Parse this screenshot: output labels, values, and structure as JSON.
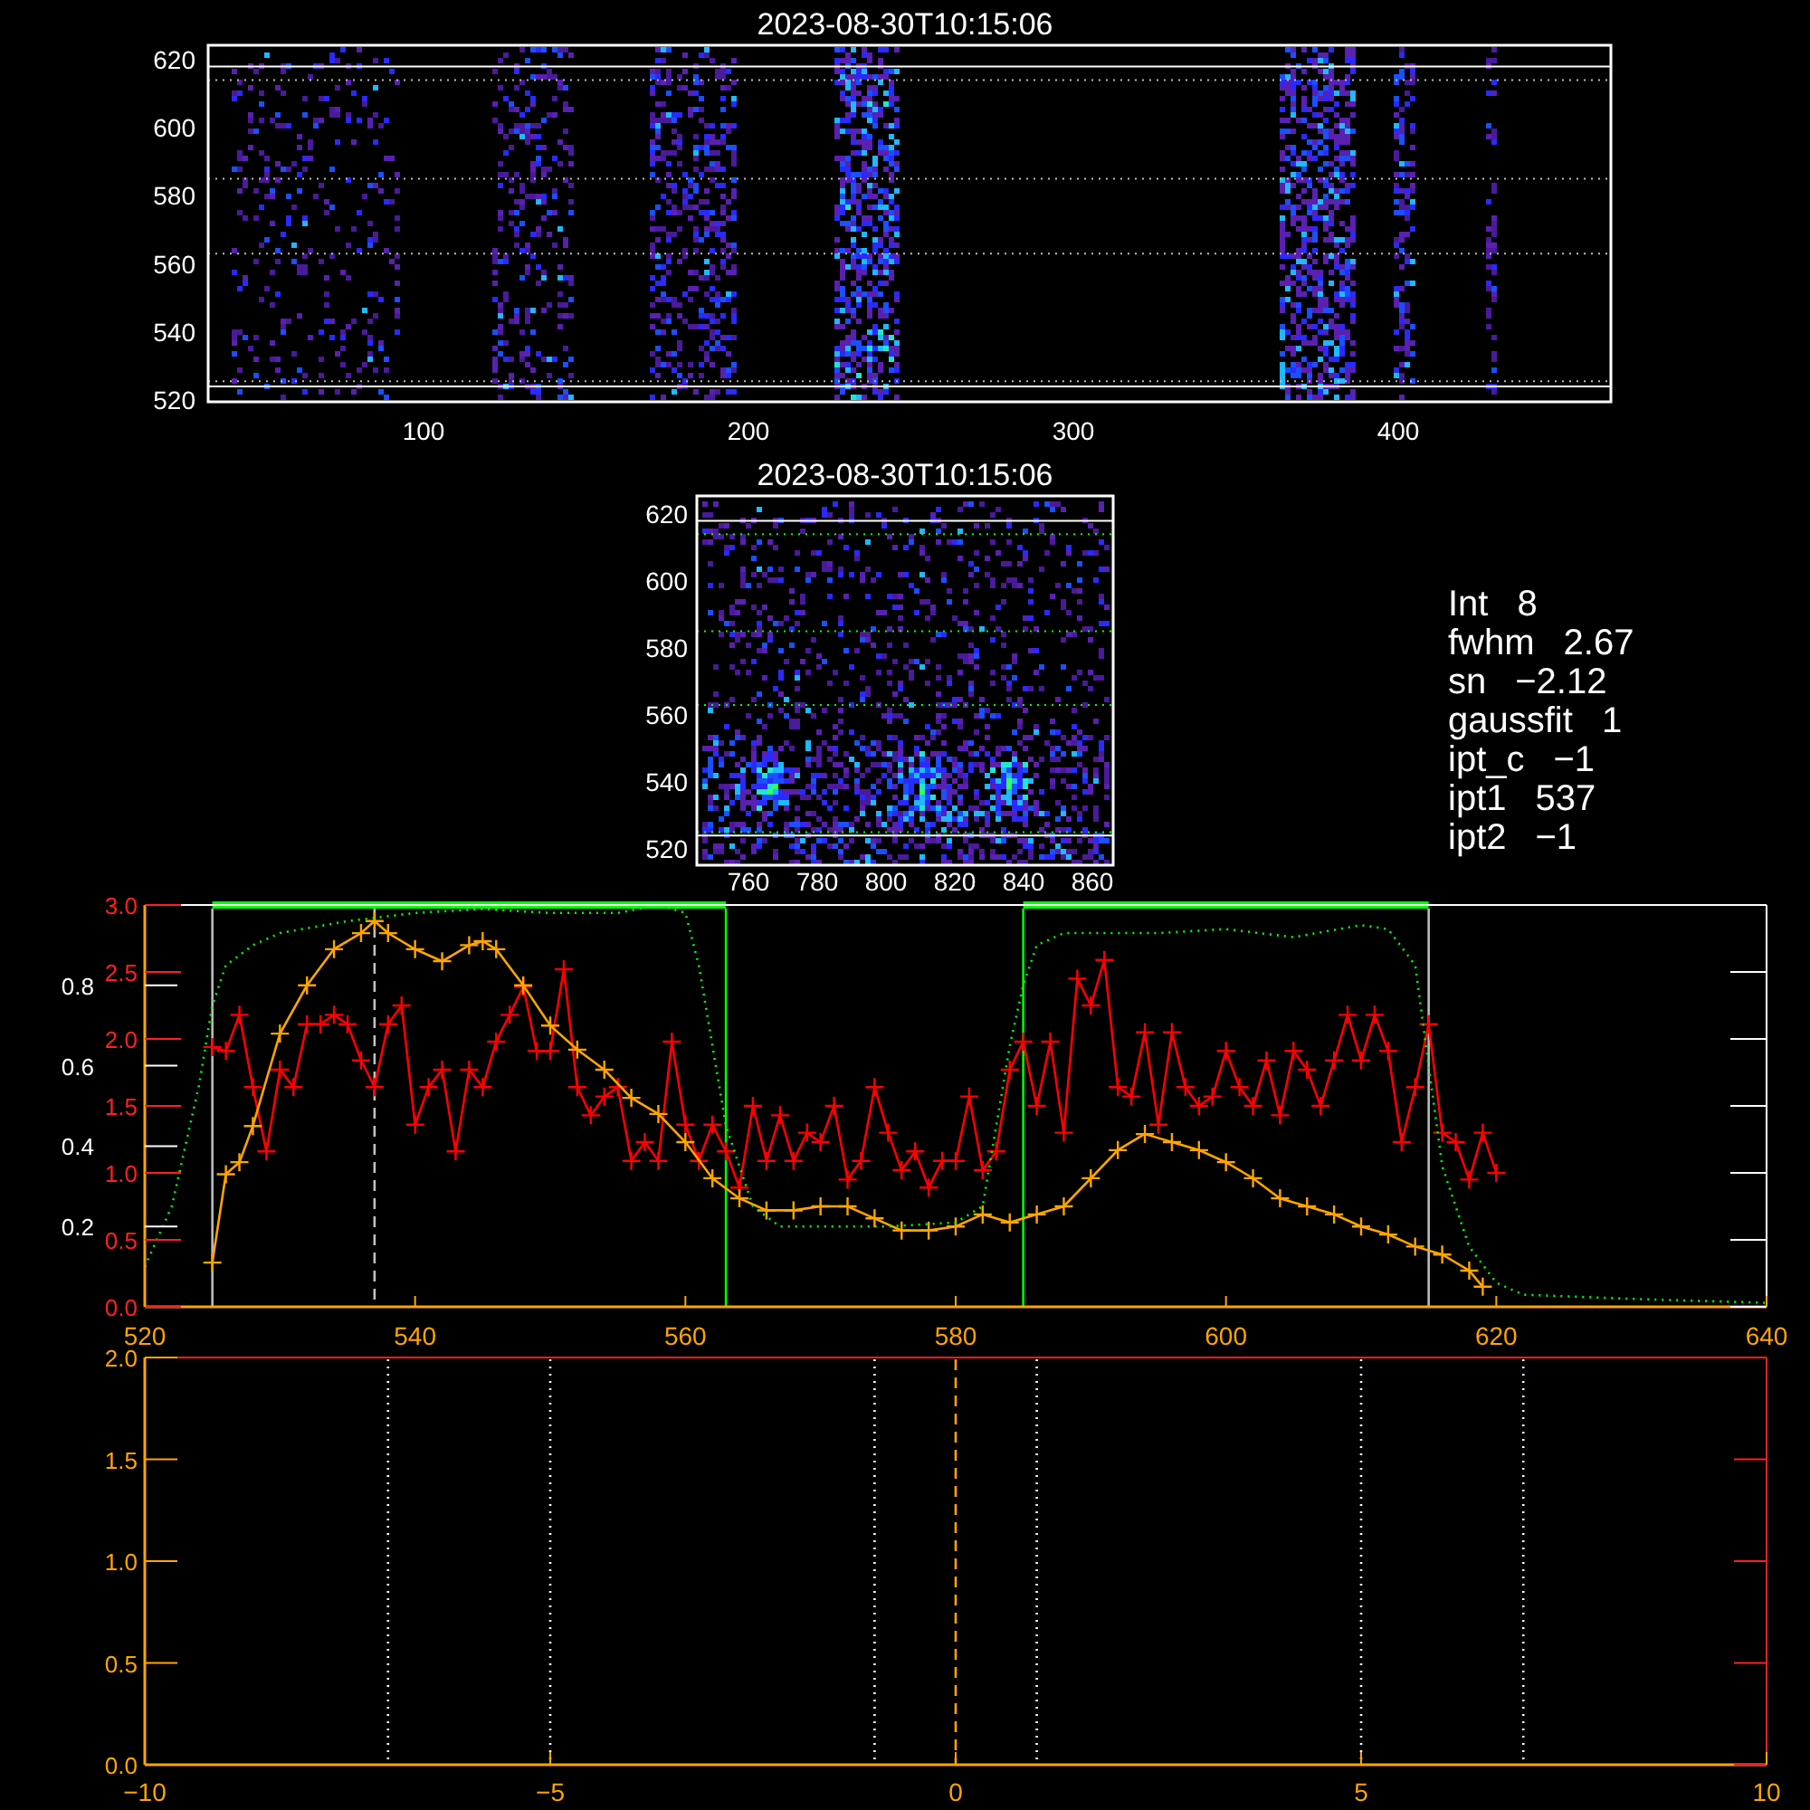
{
  "top_panel": {
    "title": "2023-08-30T10:15:06",
    "xticks": [
      "100",
      "200",
      "300",
      "400"
    ],
    "yticks": [
      "620",
      "600",
      "580",
      "560",
      "540",
      "520"
    ]
  },
  "middle_panel": {
    "title": "2023-08-30T10:15:06",
    "xticks": [
      "760",
      "780",
      "800",
      "820",
      "840",
      "860"
    ],
    "yticks": [
      "620",
      "600",
      "580",
      "560",
      "540",
      "520"
    ]
  },
  "fit_info": [
    {
      "label": "Int",
      "value": "8"
    },
    {
      "label": "fwhm",
      "value": "2.67"
    },
    {
      "label": "sn",
      "value": "−2.12"
    },
    {
      "label": "gaussfit",
      "value": "1"
    },
    {
      "label": "ipt_c",
      "value": "−1"
    },
    {
      "label": "ipt1",
      "value": "537"
    },
    {
      "label": "ipt2",
      "value": "−1"
    }
  ],
  "profile_panel": {
    "chart_data": {
      "type": "line",
      "xlim": [
        520,
        640
      ],
      "ylim": [
        0,
        3
      ],
      "xticks": [
        520,
        540,
        560,
        580,
        600,
        620,
        640
      ],
      "yticks": [
        {
          "value": 3,
          "label": "3.0"
        },
        {
          "value": 2.5,
          "label": "2.5"
        },
        {
          "value": 2,
          "label": "2.0"
        },
        {
          "value": 1.5,
          "label": "1.5"
        },
        {
          "value": 1,
          "label": "1.0"
        },
        {
          "value": 0.5,
          "label": "0.5"
        },
        {
          "value": 0,
          "label": "0.0"
        }
      ],
      "y2lim": [
        0,
        1
      ],
      "y2ticks": [
        {
          "value": 0.8,
          "label": "0.8"
        },
        {
          "value": 0.6,
          "label": "0.6"
        },
        {
          "value": 0.4,
          "label": "0.4"
        },
        {
          "value": 0.2,
          "label": "0.2"
        }
      ],
      "series": [
        {
          "color": "#ff0000",
          "marker": "+",
          "line_style": "solid",
          "x": [
            525,
            526,
            527,
            528,
            529,
            530,
            531,
            532,
            533,
            534,
            535,
            536,
            537,
            538,
            539,
            540,
            541,
            542,
            543,
            544,
            545,
            546,
            547,
            548,
            549,
            550,
            551,
            552,
            553,
            554,
            555,
            556,
            557,
            558,
            559,
            560,
            561,
            562,
            563,
            564,
            565,
            566,
            567,
            568,
            569,
            570,
            571,
            572,
            573,
            574,
            575,
            576,
            577,
            578,
            579,
            580,
            581,
            582,
            583,
            584,
            585,
            586,
            587,
            588,
            589,
            590,
            591,
            592,
            593,
            594,
            595,
            596,
            597,
            598,
            599,
            600,
            601,
            602,
            603,
            604,
            605,
            606,
            607,
            608,
            609,
            610,
            611,
            612,
            613,
            614,
            615,
            616,
            617,
            618,
            619,
            620
          ],
          "values": [
            1.94,
            1.91,
            2.18,
            1.64,
            1.16,
            1.77,
            1.64,
            2.11,
            2.11,
            2.18,
            2.11,
            1.84,
            1.64,
            2.11,
            2.25,
            1.36,
            1.64,
            1.77,
            1.16,
            1.77,
            1.64,
            1.98,
            2.18,
            2.39,
            1.91,
            1.91,
            2.52,
            1.64,
            1.43,
            1.57,
            1.64,
            1.09,
            1.23,
            1.09,
            1.98,
            1.36,
            1.09,
            1.36,
            1.16,
            0.89,
            1.5,
            1.09,
            1.43,
            1.09,
            1.3,
            1.23,
            1.5,
            0.95,
            1.09,
            1.64,
            1.3,
            1.02,
            1.16,
            0.89,
            1.09,
            1.09,
            1.57,
            1.02,
            1.16,
            1.77,
            1.98,
            1.5,
            1.98,
            1.3,
            2.45,
            2.25,
            2.59,
            1.64,
            1.57,
            2.05,
            1.36,
            2.05,
            1.64,
            1.5,
            1.57,
            1.91,
            1.64,
            1.5,
            1.84,
            1.43,
            1.91,
            1.77,
            1.5,
            1.84,
            2.18,
            1.84,
            2.18,
            1.91,
            1.23,
            1.64,
            2.11,
            1.3,
            1.23,
            0.95,
            1.3,
            1.0
          ]
        },
        {
          "color": "#ffa500",
          "axis": "y2",
          "marker": "+",
          "line_style": "solid",
          "x": [
            525,
            526,
            527,
            528,
            530,
            532,
            534,
            536,
            537,
            538,
            540,
            542,
            544,
            545,
            546,
            548,
            550,
            552,
            554,
            556,
            558,
            560,
            562,
            564,
            566,
            568,
            570,
            572,
            574,
            576,
            578,
            580,
            582,
            584,
            586,
            588,
            590,
            592,
            594,
            596,
            598,
            600,
            602,
            604,
            606,
            608,
            610,
            612,
            614,
            616,
            618,
            619
          ],
          "values": [
            0.11,
            0.33,
            0.36,
            0.45,
            0.68,
            0.8,
            0.89,
            0.93,
            0.96,
            0.93,
            0.89,
            0.86,
            0.9,
            0.91,
            0.89,
            0.8,
            0.7,
            0.64,
            0.59,
            0.52,
            0.48,
            0.41,
            0.32,
            0.27,
            0.24,
            0.24,
            0.25,
            0.25,
            0.22,
            0.19,
            0.19,
            0.2,
            0.23,
            0.21,
            0.23,
            0.25,
            0.32,
            0.39,
            0.43,
            0.41,
            0.39,
            0.36,
            0.32,
            0.27,
            0.25,
            0.23,
            0.2,
            0.18,
            0.15,
            0.13,
            0.09,
            0.05
          ]
        },
        {
          "color": "#00ff00",
          "axis": "y2",
          "line_style": "dotted",
          "x": [
            520,
            522,
            524,
            525,
            526,
            528,
            530,
            535,
            540,
            545,
            550,
            555,
            558,
            560,
            561,
            562,
            563,
            564,
            565,
            567,
            570,
            575,
            580,
            582,
            583,
            584,
            585,
            586,
            588,
            590,
            595,
            600,
            605,
            610,
            612,
            614,
            615,
            616,
            618,
            620,
            622,
            630,
            640
          ],
          "values": [
            0.1,
            0.25,
            0.55,
            0.75,
            0.85,
            0.9,
            0.93,
            0.96,
            0.98,
            0.99,
            0.98,
            0.98,
            1.0,
            0.98,
            0.85,
            0.65,
            0.45,
            0.35,
            0.25,
            0.2,
            0.2,
            0.2,
            0.21,
            0.25,
            0.45,
            0.65,
            0.8,
            0.9,
            0.93,
            0.93,
            0.93,
            0.94,
            0.92,
            0.95,
            0.94,
            0.85,
            0.6,
            0.35,
            0.15,
            0.06,
            0.03,
            0.02,
            0.01
          ]
        },
        {
          "color": "#00ff00",
          "line_style": "solid",
          "x": [
            525,
            563,
            574,
            585,
            615
          ],
          "values": [
            3.0,
            3.0,
            null,
            3.0,
            3.0
          ]
        }
      ],
      "ref_lines": [
        {
          "axis": "x",
          "value": 525,
          "color": "#bbbbbb",
          "line_style": "solid"
        },
        {
          "axis": "x",
          "value": 537,
          "color": "#c0c0c0",
          "line_style": "dashed"
        },
        {
          "axis": "x",
          "value": 563,
          "color": "#00ff00",
          "line_style": "solid"
        },
        {
          "axis": "x",
          "value": 585,
          "color": "#00ff00",
          "line_style": "solid"
        },
        {
          "axis": "x",
          "value": 615,
          "color": "#bbbbbb",
          "line_style": "solid"
        }
      ],
      "stacked": false
    }
  },
  "offset_panel": {
    "chart_data": {
      "type": "line",
      "xlim": [
        -10,
        10
      ],
      "ylim": [
        0,
        2
      ],
      "xticks": [
        {
          "value": -10,
          "label": "−10"
        },
        {
          "value": -5,
          "label": "−5"
        },
        {
          "value": 0,
          "label": "0"
        },
        {
          "value": 5,
          "label": "5"
        },
        {
          "value": 10,
          "label": "10"
        }
      ],
      "yticks": [
        {
          "value": 2,
          "label": "2.0"
        },
        {
          "value": 1.5,
          "label": "1.5"
        },
        {
          "value": 1,
          "label": "1.0"
        },
        {
          "value": 0.5,
          "label": "0.5"
        },
        {
          "value": 0,
          "label": "0.0"
        }
      ],
      "ref_lines": [
        {
          "axis": "x",
          "value": -7,
          "color": "#ffffff",
          "line_style": "dotted"
        },
        {
          "axis": "x",
          "value": -5,
          "color": "#ffffff",
          "line_style": "dotted"
        },
        {
          "axis": "x",
          "value": -1,
          "color": "#ffffff",
          "line_style": "dotted"
        },
        {
          "axis": "x",
          "value": 0,
          "color": "#ffa500",
          "line_style": "dashed"
        },
        {
          "axis": "x",
          "value": 1,
          "color": "#ffffff",
          "line_style": "dotted"
        },
        {
          "axis": "x",
          "value": 5,
          "color": "#ffffff",
          "line_style": "dotted"
        },
        {
          "axis": "x",
          "value": 7,
          "color": "#ffffff",
          "line_style": "dotted"
        }
      ]
    }
  }
}
